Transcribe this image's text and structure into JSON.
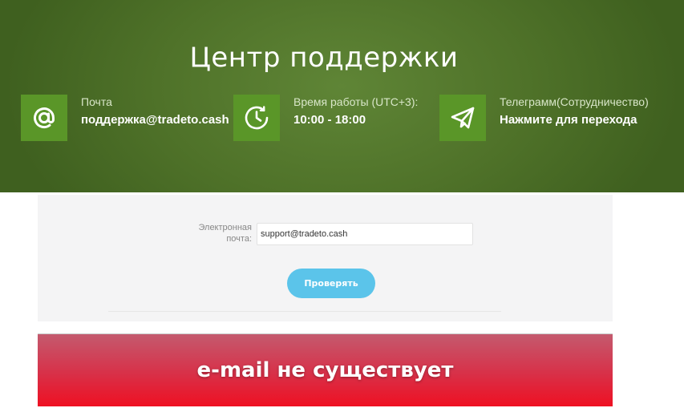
{
  "header": {
    "title": "Центр поддержки"
  },
  "contacts": [
    {
      "icon": "at-sign-icon",
      "label": "Почта",
      "value": "поддержка@tradeto.cash"
    },
    {
      "icon": "clock-icon",
      "label": "Время работы (UTC+3):",
      "value": "10:00 - 18:00"
    },
    {
      "icon": "telegram-icon",
      "label": "Телеграмм(Сотрудничество)",
      "value": "Нажмите для перехода"
    }
  ],
  "form": {
    "email_label": "Электронная почта:",
    "email_value": "support@tradeto.cash",
    "submit_label": "Проверять"
  },
  "result": {
    "message": "e-mail не существует"
  },
  "colors": {
    "hero_green": "#4f7229",
    "icon_box": "#5a9628",
    "button": "#5bc4ea",
    "error_red": "#ef1022"
  }
}
